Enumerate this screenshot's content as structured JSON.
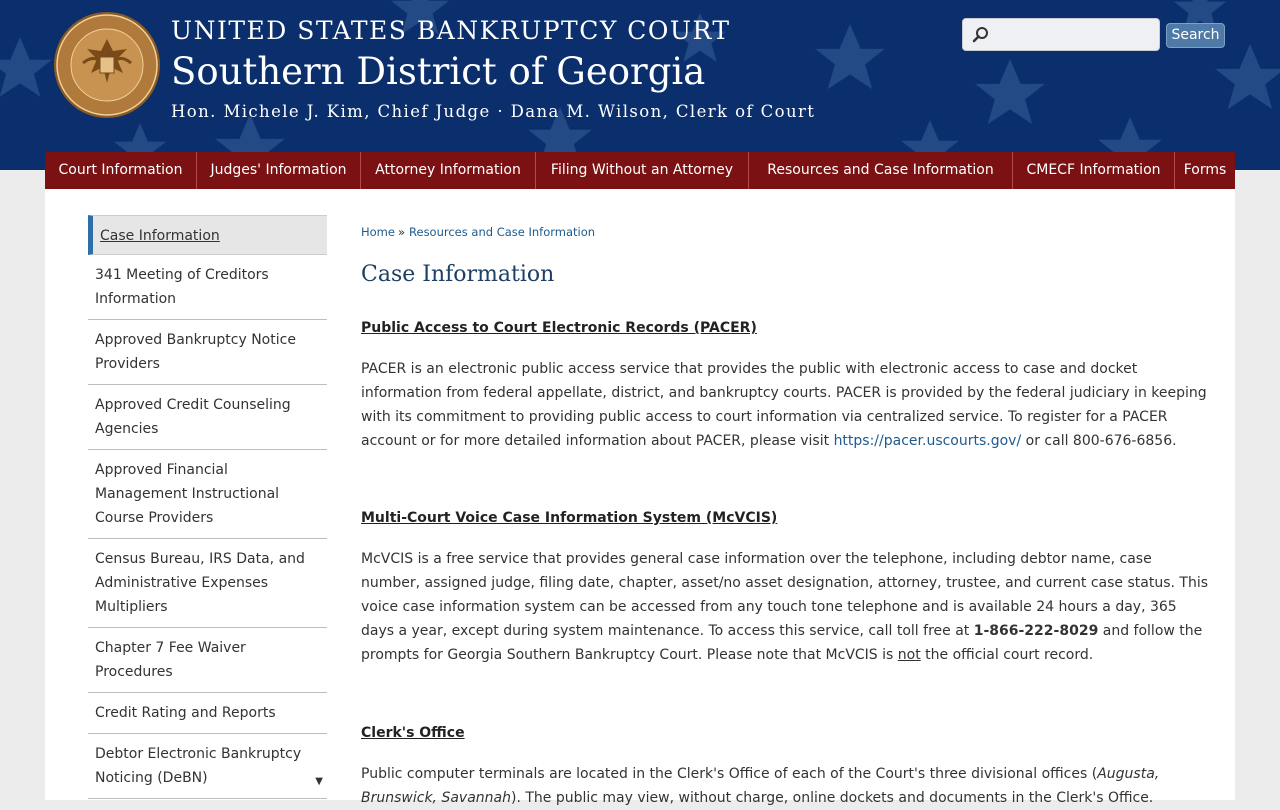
{
  "header": {
    "court_name": "UNITED STATES BANKRUPTCY COURT",
    "district": "Southern District of Georgia",
    "officials": "Hon. Michele J. Kim, Chief Judge · Dana M. Wilson, Clerk of Court",
    "seal_text": "UNITED STATES BANKRUPTCY COURT · SOUTHERN DISTRICT OF GEORGIA",
    "search_placeholder": "",
    "search_button": "Search",
    "colors": {
      "background": "#0b2f6c",
      "nav": "#7b1113",
      "search_button": "#4f79a7"
    }
  },
  "nav": {
    "items": [
      "Court Information",
      "Judges' Information",
      "Attorney Information",
      "Filing Without an Attorney",
      "Resources and Case Information",
      "CMECF Information",
      "Forms"
    ]
  },
  "sidebar": {
    "active": "Case Information",
    "items": [
      "341 Meeting of Creditors Information",
      "Approved Bankruptcy Notice Providers",
      "Approved Credit Counseling Agencies",
      "Approved Financial Management Instructional Course Providers",
      "Census Bureau, IRS Data, and Administrative Expenses Multipliers",
      "Chapter 7 Fee Waiver Procedures",
      "Credit Rating and Reports",
      "Debtor Electronic Bankruptcy Noticing (DeBN)"
    ]
  },
  "breadcrumb": {
    "home": "Home",
    "sep": "»",
    "current": "Resources and Case Information"
  },
  "page": {
    "title": "Case Information",
    "sections": {
      "pacer": {
        "title": "Public Access to Court Electronic Records (PACER)",
        "text_before_link": "PACER is an electronic public access service that provides the public with electronic access to case and docket information from federal appellate, district, and bankruptcy courts. PACER is provided by the federal judiciary in keeping with its commitment to providing public access to court information via centralized service. To register for a PACER account or for more detailed information about PACER, please visit ",
        "link": "https://pacer.uscourts.gov/",
        "text_after_link": " or call 800-676-6856."
      },
      "mcvcis": {
        "title": "Multi-Court Voice Case Information System (McVCIS)",
        "text_part1": "McVCIS is a free service that provides general case information over the telephone, including debtor name, case number, assigned judge, filing date, chapter, asset/no asset designation, attorney, trustee, and current case status. This voice case information system can be accessed from any touch tone telephone and is available 24 hours a day, 365 days a year, except during system maintenance. To access this service, call toll free at ",
        "phone": "1-866-222-8029",
        "text_part2": " and follow the prompts for Georgia Southern Bankruptcy Court. Please note that McVCIS is ",
        "not_word": "not",
        "text_part3": " the official court record."
      },
      "clerk": {
        "title": "Clerk's Office",
        "text_part1": "Public computer terminals are located in the Clerk's Office of each of the Court's three divisional offices (",
        "offices": "Augusta, Brunswick, Savannah",
        "text_part2": "). The public may view, without charge, online dockets and documents in the Clerk's Office."
      }
    }
  }
}
